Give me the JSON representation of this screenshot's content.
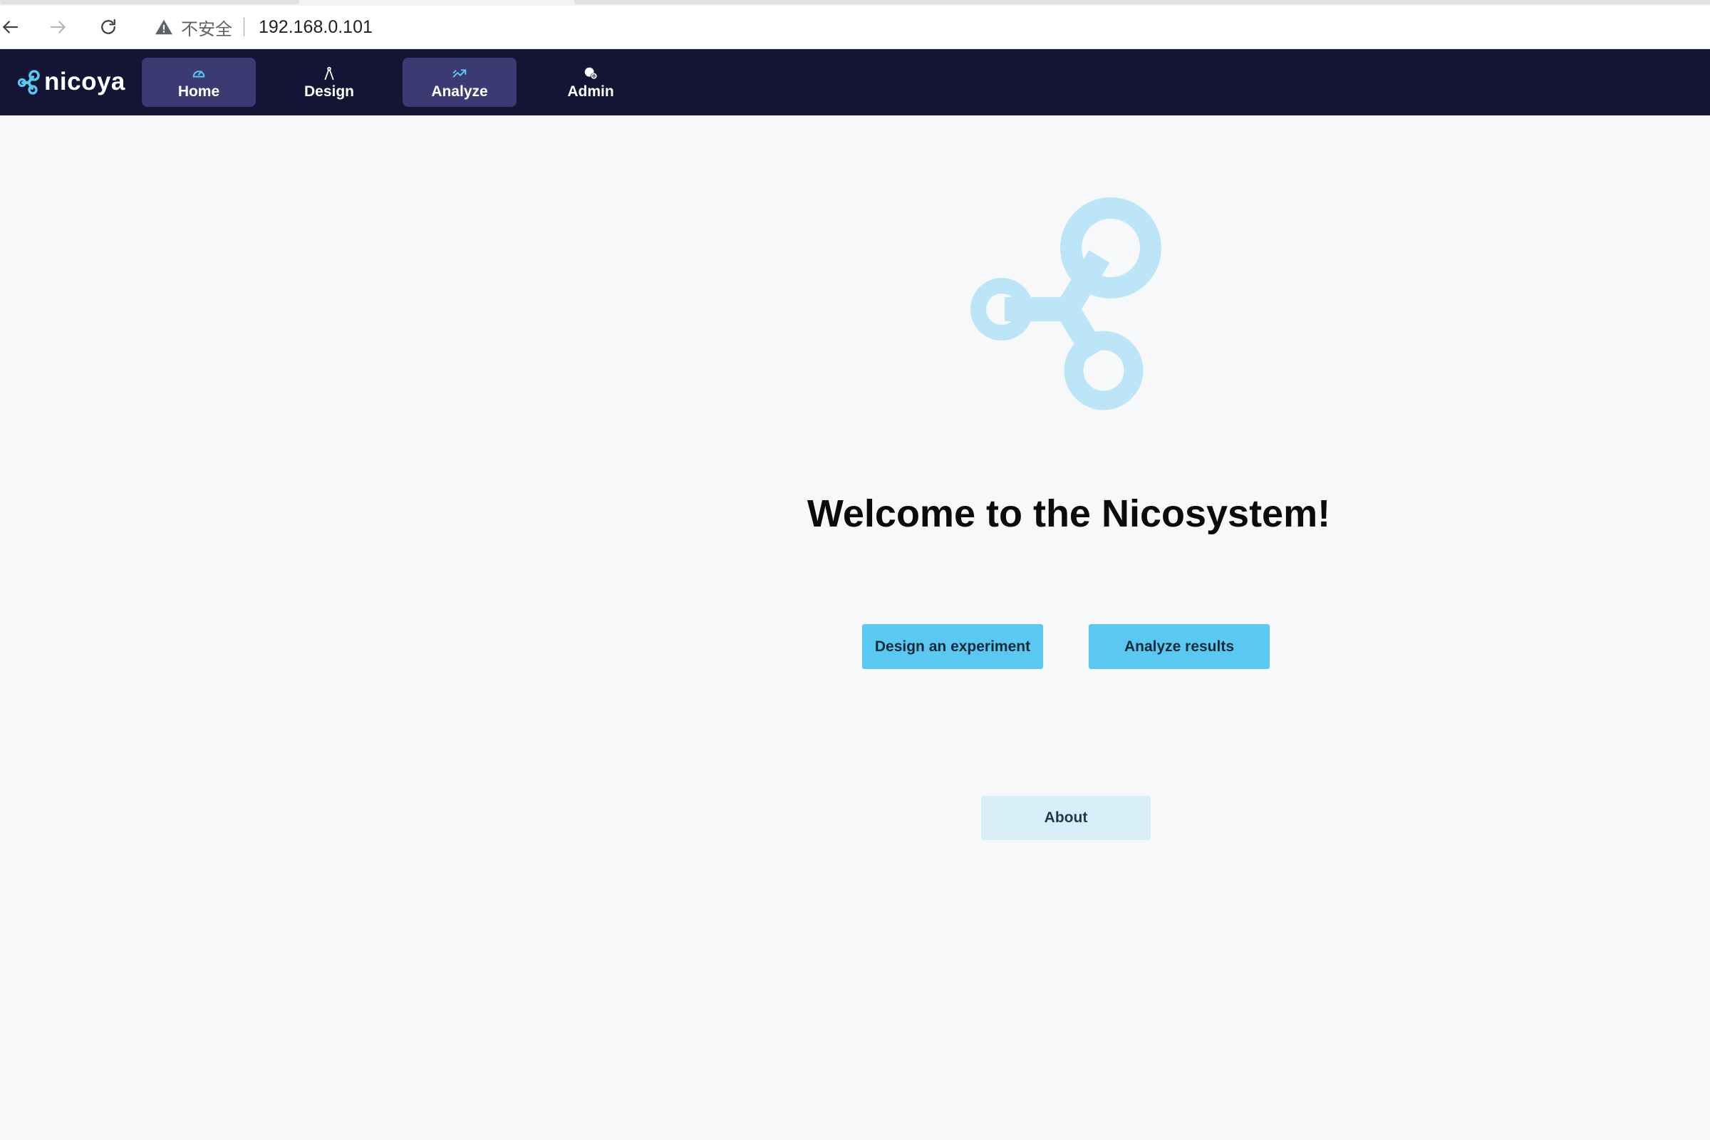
{
  "browser": {
    "security_label": "不安全",
    "url": "192.168.0.101",
    "icons": {
      "back": "arrow-left-icon",
      "forward": "arrow-right-icon",
      "reload": "reload-icon",
      "security": "warning-triangle-icon"
    }
  },
  "app": {
    "brand_name": "nicoya",
    "nav": {
      "items": [
        {
          "label": "Home",
          "icon": "gauge-icon",
          "active": true
        },
        {
          "label": "Design",
          "icon": "compass-icon",
          "active": false
        },
        {
          "label": "Analyze",
          "icon": "trend-chart-icon",
          "active": true
        },
        {
          "label": "Admin",
          "icon": "user-gear-icon",
          "active": false
        }
      ]
    }
  },
  "main": {
    "title": "Welcome to the Nicosystem!",
    "buttons": {
      "design": "Design an experiment",
      "analyze": "Analyze results",
      "about": "About"
    }
  },
  "colors": {
    "nav_background": "#141435",
    "nav_active": "#3b3a73",
    "primary_button": "#5bc8f2",
    "secondary_button": "#d8eef8",
    "hero_logo": "#bce6f7",
    "brand_accent": "#5bc8f2",
    "page_background": "#f7f8fa"
  }
}
